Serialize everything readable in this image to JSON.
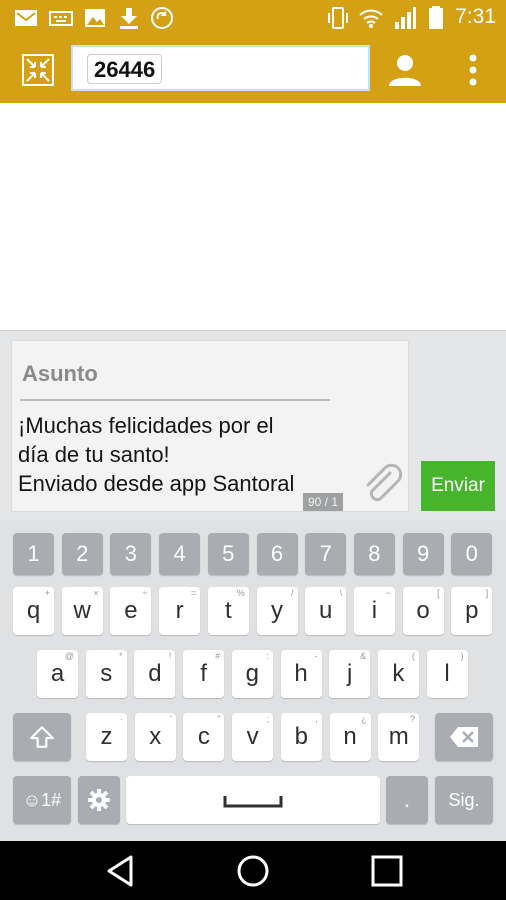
{
  "status_bar": {
    "time": "7:31",
    "icons": [
      "email-icon",
      "keyboard-icon",
      "image-icon",
      "download-icon",
      "sync-icon",
      "vibrate-icon",
      "wifi-icon",
      "signal-icon",
      "battery-icon"
    ]
  },
  "header": {
    "recipient": "26446",
    "colors": {
      "bar": "#d4a114",
      "field_border": "#c6e0ec"
    }
  },
  "compose": {
    "subject_placeholder": "Asunto",
    "message": "¡Muchas felicidades por el\ndía de tu santo!\nEnviado desde app Santoral",
    "counter": "90 / 1",
    "send_label": "Enviar",
    "send_color": "#47b52c"
  },
  "keyboard": {
    "numbers": [
      "1",
      "2",
      "3",
      "4",
      "5",
      "6",
      "7",
      "8",
      "9",
      "0"
    ],
    "row1": [
      {
        "k": "q",
        "s": "+"
      },
      {
        "k": "w",
        "s": "×"
      },
      {
        "k": "e",
        "s": "÷"
      },
      {
        "k": "r",
        "s": "="
      },
      {
        "k": "t",
        "s": "%"
      },
      {
        "k": "y",
        "s": "/"
      },
      {
        "k": "u",
        "s": "\\"
      },
      {
        "k": "i",
        "s": "−"
      },
      {
        "k": "o",
        "s": "["
      },
      {
        "k": "p",
        "s": "]"
      }
    ],
    "row2": [
      {
        "k": "a",
        "s": "@"
      },
      {
        "k": "s",
        "s": "*"
      },
      {
        "k": "d",
        "s": "!"
      },
      {
        "k": "f",
        "s": "#"
      },
      {
        "k": "g",
        "s": ":"
      },
      {
        "k": "h",
        "s": "-"
      },
      {
        "k": "j",
        "s": "&"
      },
      {
        "k": "k",
        "s": "("
      },
      {
        "k": "l",
        "s": ")"
      }
    ],
    "row3": [
      {
        "k": "z",
        "s": "·"
      },
      {
        "k": "x",
        "s": "'"
      },
      {
        "k": "c",
        "s": "\""
      },
      {
        "k": "v",
        "s": ";"
      },
      {
        "k": "b",
        "s": ","
      },
      {
        "k": "n",
        "s": "¿"
      },
      {
        "k": "m",
        "s": "?"
      }
    ],
    "symbols_label": "☺1#",
    "period_label": ".",
    "next_label": "Sig."
  },
  "nav_bar": {
    "icons": [
      "back-icon",
      "home-icon",
      "recents-icon"
    ]
  }
}
